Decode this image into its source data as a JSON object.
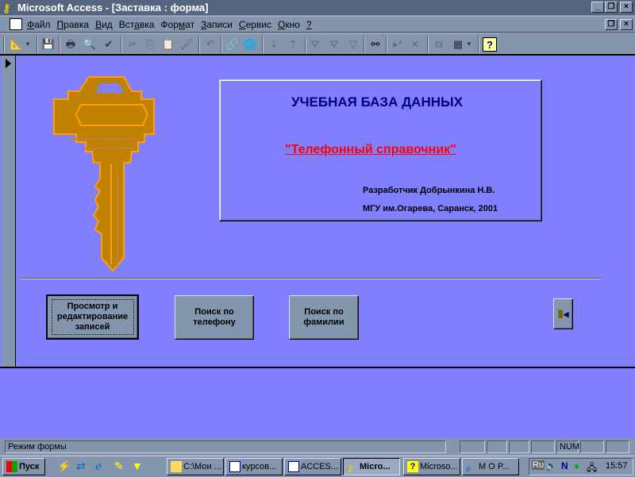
{
  "window": {
    "title": "Microsoft Access - [Заставка : форма]"
  },
  "menu": [
    {
      "u": "Ф",
      "rest": "айл"
    },
    {
      "u": "П",
      "rest": "равка"
    },
    {
      "u": "В",
      "rest": "ид"
    },
    {
      "pre": "Вст",
      "u": "а",
      "rest": "вка"
    },
    {
      "pre": "Фор",
      "u": "м",
      "rest": "ат"
    },
    {
      "u": "З",
      "rest": "аписи"
    },
    {
      "u": "С",
      "rest": "ервис"
    },
    {
      "u": "О",
      "rest": "кно"
    },
    {
      "u": "?",
      "rest": ""
    }
  ],
  "form": {
    "heading": "УЧЕБНАЯ БАЗА ДАННЫХ",
    "subtitle": "\"Телефонный справочник\"",
    "author": "Разработчик Добрынкина Н.В.",
    "org": "МГУ им.Огарева, Саранск, 2001",
    "buttons": {
      "browse": "Просмотр и редактирование записей",
      "by_phone": "Поиск по телефону",
      "by_name": "Поиск по фамилии"
    }
  },
  "status": {
    "mode": "Режим формы",
    "num": "NUM"
  },
  "taskbar": {
    "start": "Пуск",
    "tasks": [
      "C:\\Мои ...",
      "курсов...",
      "ACCES...",
      "Micro...",
      "Microso...",
      "М О Р..."
    ],
    "lang": "Ru",
    "clock": "15:57"
  },
  "colors": {
    "form_bg": "#8080ff",
    "heading": "#000080",
    "subtitle": "#ff0000",
    "key": "#c08000"
  }
}
